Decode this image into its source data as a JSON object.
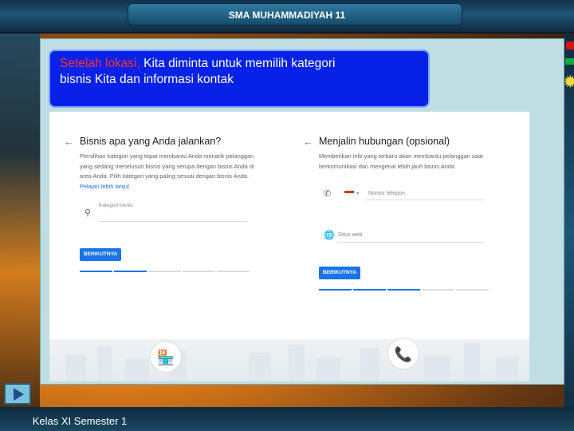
{
  "header": {
    "title": "SMA MUHAMMADIYAH 11"
  },
  "callout": {
    "highlight": "Setelah lokasi,",
    "line1_rest": " Kita diminta untuk memilih kategori",
    "line2": "bisnis Kita dan informasi kontak"
  },
  "screenshot": {
    "left": {
      "title": "Bisnis apa yang Anda jalankan?",
      "description": "Pemilihan kategori yang tepat membantu Anda menarik pelanggan yang sedang menelusuri bisnis yang serupa dengan bisnis Anda di area Anda. Pilih kategori yang paling sesuai dengan bisnis Anda.",
      "link": "Pelajari lebih lanjut",
      "field_label": "Kategori bisnis",
      "button": "BERIKUTNYA",
      "progress_steps_done": 2,
      "progress_steps_total": 5
    },
    "right": {
      "title": "Menjalin hubungan (opsional)",
      "description": "Memberikan info yang terbaru akan membantu pelanggan saat berkomunikasi dan mengenal lebih jauh bisnis Anda",
      "phone_placeholder": "Nomor telepon",
      "website_placeholder": "Situs web",
      "button": "BERIKUTNYA",
      "progress_steps_done": 3,
      "progress_steps_total": 5
    },
    "accent_color": "#1a73e8"
  },
  "footer": {
    "label": "Kelas XI Semester 1"
  }
}
